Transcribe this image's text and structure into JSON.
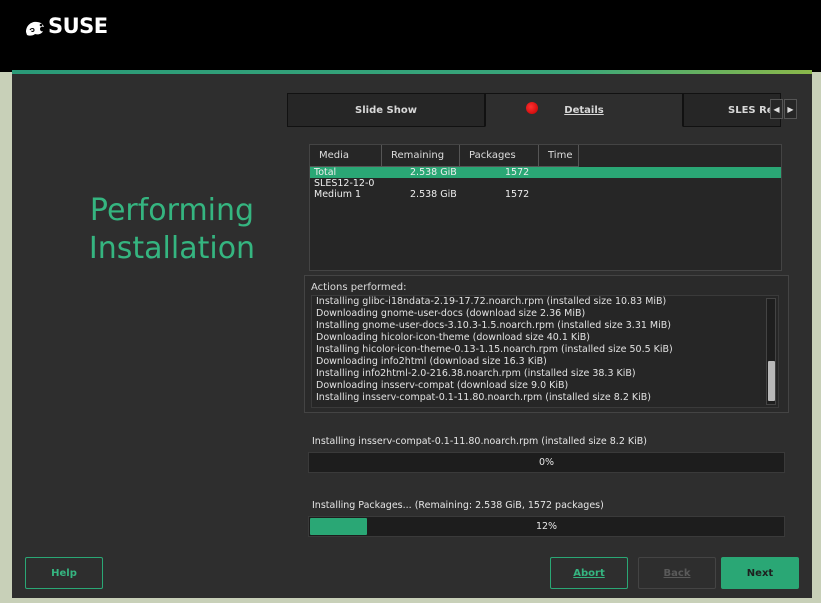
{
  "brand": {
    "logo_text": "SUSE",
    "logo_icon": "chameleon-icon"
  },
  "page_title_line1": "Performing",
  "page_title_line2": "Installation",
  "tabs": [
    {
      "label": "Slide Show",
      "active": false
    },
    {
      "label": "Details",
      "active": true
    },
    {
      "label": "SLES Re",
      "active": false
    }
  ],
  "tab_nav": {
    "prev": "◀",
    "next": "▶"
  },
  "media_table": {
    "headers": [
      "Media",
      "Remaining",
      "Packages",
      "Time"
    ],
    "rows": [
      {
        "media": "Total",
        "remaining": "2.538 GiB",
        "packages": "1572",
        "time": "",
        "selected": true
      },
      {
        "media": "SLES12-12-0",
        "remaining": "",
        "packages": "",
        "time": "",
        "selected": false
      },
      {
        "media": "Medium 1",
        "remaining": "2.538 GiB",
        "packages": "1572",
        "time": "",
        "selected": false
      }
    ]
  },
  "actions": {
    "label": "Actions performed:",
    "lines": [
      "Installing glibc-i18ndata-2.19-17.72.noarch.rpm (installed size 10.83 MiB)",
      "Downloading gnome-user-docs (download size 2.36 MiB)",
      "Installing gnome-user-docs-3.10.3-1.5.noarch.rpm (installed size 3.31 MiB)",
      "Downloading hicolor-icon-theme (download size 40.1 KiB)",
      "Installing hicolor-icon-theme-0.13-1.15.noarch.rpm (installed size 50.5 KiB)",
      "Downloading info2html (download size 16.3 KiB)",
      "Installing info2html-2.0-216.38.noarch.rpm (installed size 38.3 KiB)",
      "Downloading insserv-compat (download size 9.0 KiB)",
      "Installing insserv-compat-0.1-11.80.noarch.rpm (installed size 8.2 KiB)"
    ]
  },
  "progress_current": {
    "label": "Installing insserv-compat-0.1-11.80.noarch.rpm (installed size 8.2 KiB)",
    "text": "0%",
    "fraction": 0.0
  },
  "progress_total": {
    "label": "Installing Packages... (Remaining: 2.538 GiB, 1572 packages)",
    "text": "12%",
    "fraction": 0.12
  },
  "buttons": {
    "help": "Help",
    "abort": "Abort",
    "back": "Back",
    "next": "Next"
  },
  "colors": {
    "accent": "#2aa775",
    "title": "#35b580",
    "status_dot": "#e01010"
  }
}
